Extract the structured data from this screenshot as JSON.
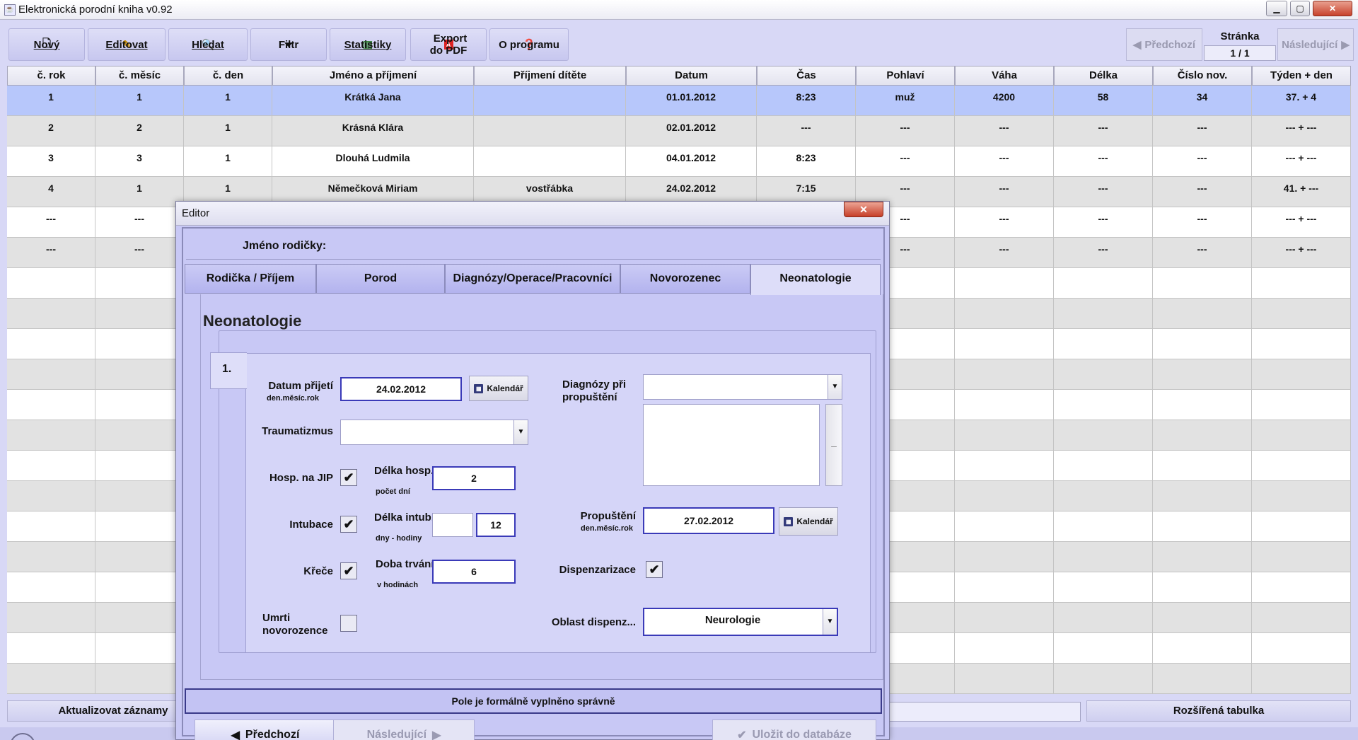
{
  "window": {
    "title": "Elektronická porodní kniha v0.92",
    "min": "▁",
    "max": "▢",
    "close": "✕"
  },
  "toolbar": {
    "new": "Nový",
    "edit": "Editovat",
    "search": "Hledat",
    "filter": "Filtr",
    "stats": "Statistiky",
    "export_line1": "Export",
    "export_line2": "do PDF",
    "about": "O programu"
  },
  "pager": {
    "prev": "Předchozí",
    "label": "Stránka",
    "value": "1 / 1",
    "next": "Následující"
  },
  "table": {
    "columns": [
      "č. rok",
      "č. měsíc",
      "č. den",
      "Jméno a příjmení",
      "Příjmení dítěte",
      "Datum",
      "Čas",
      "Pohlaví",
      "Váha",
      "Délka",
      "Číslo nov.",
      "Týden + den"
    ],
    "rows": [
      [
        "1",
        "1",
        "1",
        "Krátká Jana",
        "",
        "01.01.2012",
        "8:23",
        "muž",
        "4200",
        "58",
        "34",
        "37. + 4"
      ],
      [
        "2",
        "2",
        "1",
        "Krásná Klára",
        "",
        "02.01.2012",
        "---",
        "---",
        "---",
        "---",
        "---",
        "--- + ---"
      ],
      [
        "3",
        "3",
        "1",
        "Dlouhá Ludmila",
        "",
        "04.01.2012",
        "8:23",
        "---",
        "---",
        "---",
        "---",
        "--- + ---"
      ],
      [
        "4",
        "1",
        "1",
        "Němečková Miriam",
        "vostřábka",
        "24.02.2012",
        "7:15",
        "---",
        "---",
        "---",
        "---",
        "41. + ---"
      ],
      [
        "---",
        "---",
        "",
        "",
        "",
        "",
        "",
        "---",
        "---",
        "---",
        "---",
        "--- + ---"
      ],
      [
        "---",
        "---",
        "",
        "",
        "",
        "",
        "",
        "---",
        "---",
        "---",
        "---",
        "--- + ---"
      ]
    ]
  },
  "bottom": {
    "update": "Aktualizovat záznamy",
    "extended": "Rozšířená tabulka"
  },
  "editor": {
    "title": "Editor",
    "close": "✕",
    "mother_label": "Jméno rodičky:",
    "tabs": [
      "Rodička / Příjem",
      "Porod",
      "Diagnózy/Operace/Pracovníci",
      "Novorozenec",
      "Neonatologie"
    ],
    "active_tab": "Neonatologie",
    "section_title": "Neonatologie",
    "subtab": "1.",
    "admission_label": "Datum přijetí",
    "admission_sub": "den.měsíc.rok",
    "admission_value": "24.02.2012",
    "calendar_label": "Kalendář",
    "trauma_label": "Traumatizmus",
    "icu_label": "Hosp. na JIP",
    "icu_checked": "✔",
    "stay_label": "Délka hosp.",
    "stay_sub": "počet dní",
    "stay_value": "2",
    "intub_label": "Intubace",
    "intub_checked": "✔",
    "intub_len_label": "Délka intub.",
    "intub_len_sub": "dny - hodiny",
    "intub_days": "",
    "intub_hours": "12",
    "seizure_label": "Křeče",
    "seizure_checked": "✔",
    "seizure_dur_label": "Doba trvání",
    "seizure_dur_sub": "v hodinách",
    "seizure_dur_value": "6",
    "death_label_1": "Umrti",
    "death_label_2": "novorozence",
    "diag_label_1": "Diagnózy při",
    "diag_label_2": "propuštění",
    "discharge_label": "Propuštění",
    "discharge_sub": "den.měsíc.rok",
    "discharge_value": "27.02.2012",
    "disp_label": "Dispenzarizace",
    "disp_checked": "✔",
    "disp_area_label": "Oblast dispenz...",
    "disp_area_value": "Neurologie",
    "status": "Pole je formálně vyplněno správně",
    "prev": "Předchozí",
    "next": "Následující",
    "save": "Uložit do databáze"
  }
}
